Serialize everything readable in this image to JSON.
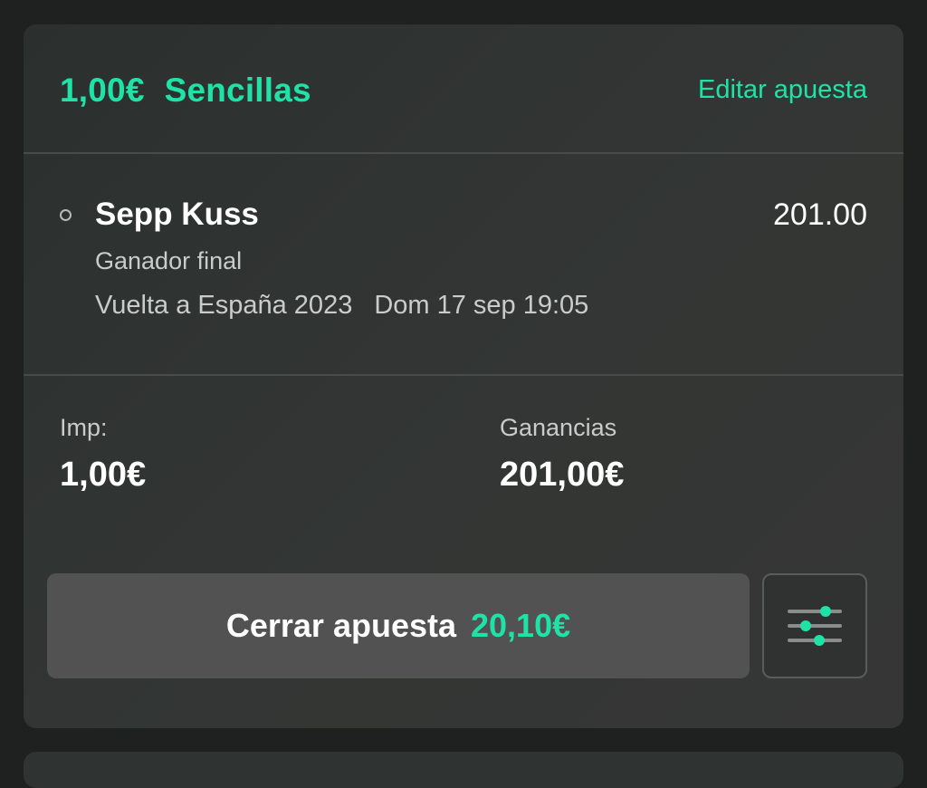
{
  "header": {
    "stake": "1,00€",
    "bet_type": "Sencillas",
    "edit_label": "Editar apuesta"
  },
  "selection": {
    "name": "Sepp Kuss",
    "odds": "201.00",
    "market": "Ganador final",
    "event": "Vuelta a España 2023",
    "datetime": "Dom 17 sep 19:05"
  },
  "amounts": {
    "stake_label": "Imp:",
    "stake_value": "1,00€",
    "winnings_label": "Ganancias",
    "winnings_value": "201,00€"
  },
  "actions": {
    "cashout_label": "Cerrar apuesta",
    "cashout_amount": "20,10€",
    "settings_icon": "sliders-icon"
  },
  "colors": {
    "accent": "#1fe3a6",
    "card_background": "#313432",
    "button_background": "#525252",
    "page_background": "#1f2120"
  }
}
